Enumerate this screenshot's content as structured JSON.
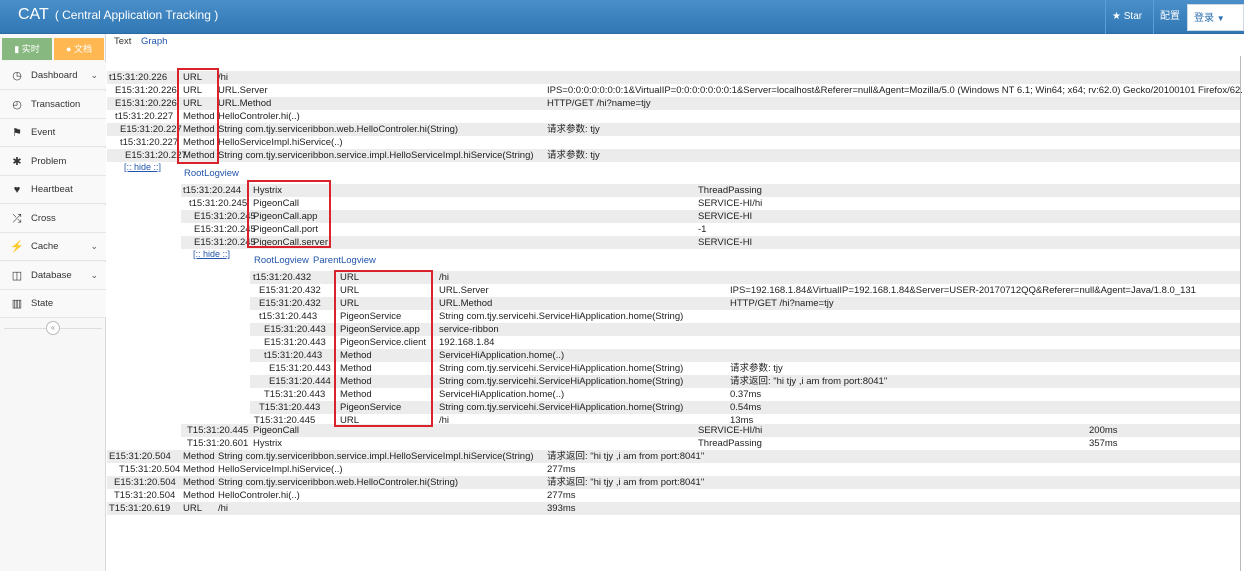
{
  "app": {
    "title": "CAT",
    "subtitle": "( Central Application Tracking )"
  },
  "topbar": {
    "star": "Star",
    "config": "配置",
    "login": "登录"
  },
  "shortcuts": {
    "realtime": "实时",
    "docs": "文档"
  },
  "sidebar": {
    "items": [
      {
        "label": "Dashboard",
        "icon": "dashboard-icon",
        "glyph": "◷",
        "chevron": true
      },
      {
        "label": "Transaction",
        "icon": "clock-icon",
        "glyph": "◴",
        "chevron": false
      },
      {
        "label": "Event",
        "icon": "flag-icon",
        "glyph": "⚑",
        "chevron": false
      },
      {
        "label": "Problem",
        "icon": "bug-icon",
        "glyph": "✱",
        "chevron": false
      },
      {
        "label": "Heartbeat",
        "icon": "heart-icon",
        "glyph": "♥",
        "chevron": false
      },
      {
        "label": "Cross",
        "icon": "random-icon",
        "glyph": "⤮",
        "chevron": false
      },
      {
        "label": "Cache",
        "icon": "bolt-icon",
        "glyph": "⚡",
        "chevron": true
      },
      {
        "label": "Database",
        "icon": "database-icon",
        "glyph": "◫",
        "chevron": true
      },
      {
        "label": "State",
        "icon": "bar-chart-icon",
        "glyph": "▥",
        "chevron": false
      }
    ]
  },
  "tabs": {
    "text": "Text",
    "graph": "Graph"
  },
  "links": {
    "hide": "[:: hide ::]",
    "root_logview": "RootLogview",
    "parent_logview": "ParentLogview"
  },
  "log1": [
    [
      "t15:31:20.226",
      "URL",
      "/hi",
      "",
      ""
    ],
    [
      "E15:31:20.226",
      "URL",
      "URL.Server",
      "IPS=0:0:0:0:0:0:0:1&VirtualIP=0:0:0:0:0:0:0:1&Server=localhost&Referer=null&Agent=Mozilla/5.0 (Windows NT 6.1; Win64; x64; rv:62.0) Gecko/20100101 Firefox/62.",
      ""
    ],
    [
      "E15:31:20.226",
      "URL",
      "URL.Method",
      "HTTP/GET /hi?name=tjy",
      ""
    ],
    [
      "t15:31:20.227",
      "Method",
      "HelloControler.hi(..)",
      "",
      ""
    ],
    [
      "E15:31:20.227",
      "Method",
      "String com.tjy.serviceribbon.web.HelloControler.hi(String)",
      "请求参数: tjy",
      ""
    ],
    [
      "t15:31:20.227",
      "Method",
      "HelloServiceImpl.hiService(..)",
      "",
      ""
    ],
    [
      "E15:31:20.227",
      "Method",
      "String com.tjy.serviceribbon.service.impl.HelloServiceImpl.hiService(String)",
      "请求参数: tjy",
      ""
    ]
  ],
  "log2": [
    [
      "t15:31:20.244",
      "Hystrix",
      "",
      "ThreadPassing",
      ""
    ],
    [
      "t15:31:20.245",
      "PigeonCall",
      "",
      "SERVICE-HI/hi",
      ""
    ],
    [
      "E15:31:20.245",
      "PigeonCall.app",
      "",
      "SERVICE-HI",
      ""
    ],
    [
      "E15:31:20.245",
      "PigeonCall.port",
      "",
      "-1",
      ""
    ],
    [
      "E15:31:20.245",
      "PigeonCall.server",
      "",
      "SERVICE-HI",
      ""
    ]
  ],
  "log3": [
    [
      "t15:31:20.432",
      "URL",
      "/hi",
      "",
      ""
    ],
    [
      "E15:31:20.432",
      "URL",
      "URL.Server",
      "IPS=192.168.1.84&VirtualIP=192.168.1.84&Server=USER-20170712QQ&Referer=null&Agent=Java/1.8.0_131",
      ""
    ],
    [
      "E15:31:20.432",
      "URL",
      "URL.Method",
      "HTTP/GET /hi?name=tjy",
      ""
    ],
    [
      "t15:31:20.443",
      "PigeonService",
      "String com.tjy.servicehi.ServiceHiApplication.home(String)",
      "",
      ""
    ],
    [
      "E15:31:20.443",
      "PigeonService.app",
      "service-ribbon",
      "",
      ""
    ],
    [
      "E15:31:20.443",
      "PigeonService.client",
      "192.168.1.84",
      "",
      ""
    ],
    [
      "t15:31:20.443",
      "Method",
      "ServiceHiApplication.home(..)",
      "",
      ""
    ],
    [
      "E15:31:20.443",
      "Method",
      "String com.tjy.servicehi.ServiceHiApplication.home(String)",
      "请求参数: tjy",
      ""
    ],
    [
      "E15:31:20.444",
      "Method",
      "String com.tjy.servicehi.ServiceHiApplication.home(String)",
      "请求返回: \"hi tjy ,i am from port:8041\"",
      ""
    ],
    [
      "T15:31:20.443",
      "Method",
      "ServiceHiApplication.home(..)",
      "0.37ms",
      ""
    ],
    [
      "T15:31:20.443",
      "PigeonService",
      "String com.tjy.servicehi.ServiceHiApplication.home(String)",
      "0.54ms",
      ""
    ],
    [
      "T15:31:20.445",
      "URL",
      "/hi",
      "13ms",
      ""
    ]
  ],
  "log4": [
    [
      "T15:31:20.445",
      "PigeonCall",
      "",
      "SERVICE-HI/hi",
      "200ms"
    ],
    [
      "T15:31:20.601",
      "Hystrix",
      "",
      "ThreadPassing",
      "357ms"
    ]
  ],
  "log5": [
    [
      "E15:31:20.504",
      "Method",
      "String com.tjy.serviceribbon.service.impl.HelloServiceImpl.hiService(String)",
      "请求返回: \"hi tjy ,i am from port:8041\"",
      ""
    ],
    [
      "T15:31:20.504",
      "Method",
      "HelloServiceImpl.hiService(..)",
      "277ms",
      ""
    ],
    [
      "E15:31:20.504",
      "Method",
      "String com.tjy.serviceribbon.web.HelloControler.hi(String)",
      "请求返回: \"hi tjy ,i am from port:8041\"",
      ""
    ],
    [
      "T15:31:20.504",
      "Method",
      "HelloControler.hi(..)",
      "277ms",
      ""
    ],
    [
      "T15:31:20.619",
      "URL",
      "/hi",
      "393ms",
      ""
    ]
  ]
}
